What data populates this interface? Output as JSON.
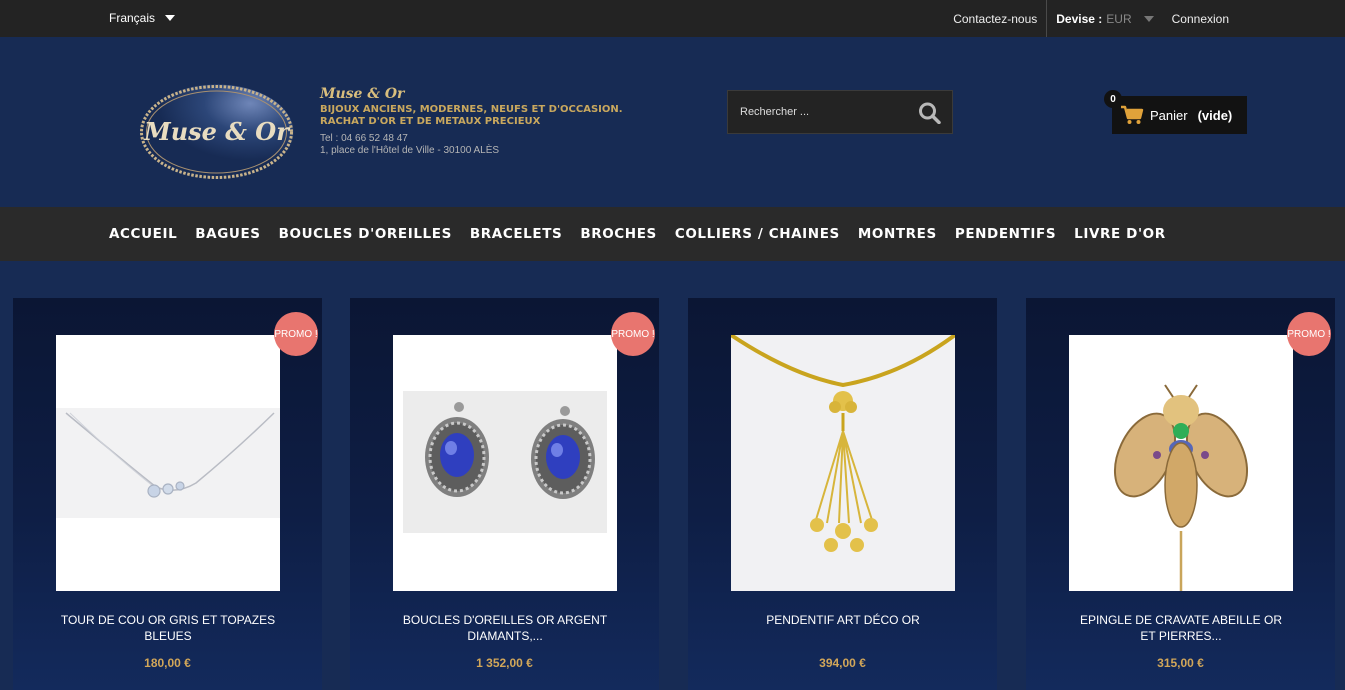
{
  "topbar": {
    "language": "Français",
    "contact": "Contactez-nous",
    "currency_label": "Devise :",
    "currency_value": "EUR",
    "login": "Connexion"
  },
  "header": {
    "logo_text": "Muse & Or",
    "brand_name": "Muse & Or",
    "tagline_1": "BIJOUX ANCIENS, MODERNES, NEUFS ET D'OCCASION.",
    "tagline_2": "RACHAT D'OR ET DE METAUX PRECIEUX",
    "phone": "Tel : 04 66 52 48 47",
    "address": "1, place de l'Hôtel de Ville - 30100 ALÈS"
  },
  "search": {
    "placeholder": "Rechercher ...",
    "icon": "search-icon"
  },
  "cart": {
    "count": "0",
    "label": "Panier",
    "status": "(vide)",
    "icon": "cart-icon"
  },
  "nav": {
    "items": [
      "ACCUEIL",
      "BAGUES",
      "BOUCLES D'OREILLES",
      "BRACELETS",
      "BROCHES",
      "COLLIERS / CHAINES",
      "MONTRES",
      "PENDENTIFS",
      "LIVRE D'OR"
    ]
  },
  "products": [
    {
      "title_line1": "TOUR DE COU OR GRIS ET TOPAZES",
      "title_line2": "BLEUES",
      "price": "180,00 €",
      "badge": "PROMO !"
    },
    {
      "title_line1": "BOUCLES D'OREILLES OR ARGENT",
      "title_line2": "DIAMANTS,...",
      "price": "1 352,00 €",
      "badge": "PROMO !"
    },
    {
      "title_line1": "PENDENTIF ART DÉCO OR",
      "title_line2": "",
      "price": "394,00 €",
      "badge": ""
    },
    {
      "title_line1": "EPINGLE DE CRAVATE ABEILLE OR",
      "title_line2": "ET PIERRES...",
      "price": "315,00 €",
      "badge": "PROMO !"
    }
  ],
  "colors": {
    "background": "#172b54",
    "topbar": "#232323",
    "nav": "#2a2a2a",
    "price": "#d1a659",
    "promo": "#e8756f",
    "brand_gold": "#d9be7d"
  }
}
